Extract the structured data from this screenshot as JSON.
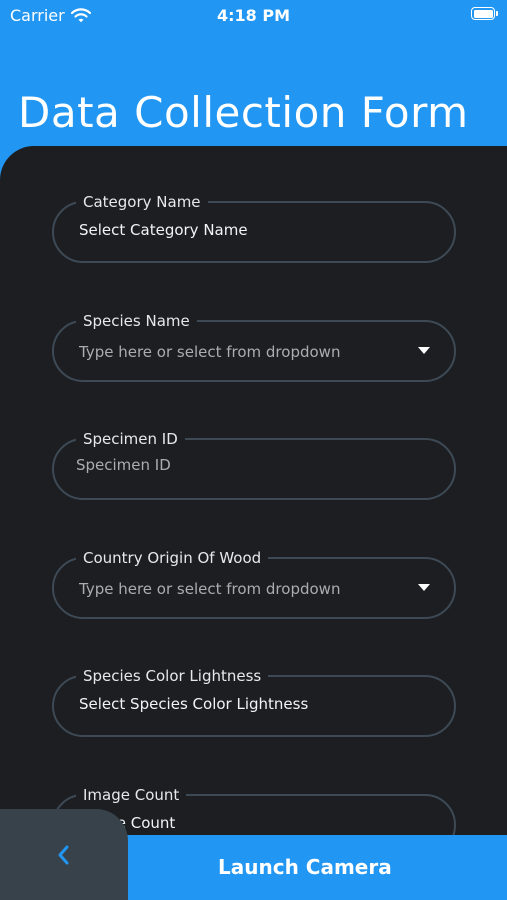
{
  "status_bar": {
    "carrier": "Carrier",
    "time": "4:18 PM",
    "icons": [
      "wifi-icon",
      "battery-icon"
    ]
  },
  "header": {
    "title": "Data Collection Form"
  },
  "form": {
    "fields": [
      {
        "label": "Category Name",
        "value": "Select Category Name",
        "type": "select"
      },
      {
        "label": "Species Name",
        "placeholder": "Type here or select from dropdown",
        "type": "dropdown"
      },
      {
        "label": "Specimen ID",
        "placeholder": "Specimen ID",
        "type": "text"
      },
      {
        "label": "Country Origin Of Wood",
        "placeholder": "Type here or select from dropdown",
        "type": "dropdown"
      },
      {
        "label": "Species Color Lightness",
        "value": "Select Species Color Lightness",
        "type": "select"
      },
      {
        "label": "Image Count",
        "value": "Image Count",
        "type": "text"
      }
    ]
  },
  "bottom": {
    "back_icon": "chevron-left-icon",
    "launch_label": "Launch Camera"
  },
  "colors": {
    "accent": "#2196F3",
    "panel": "#1d1e22",
    "field_border": "#3d4a55",
    "back_button": "#37424b"
  }
}
